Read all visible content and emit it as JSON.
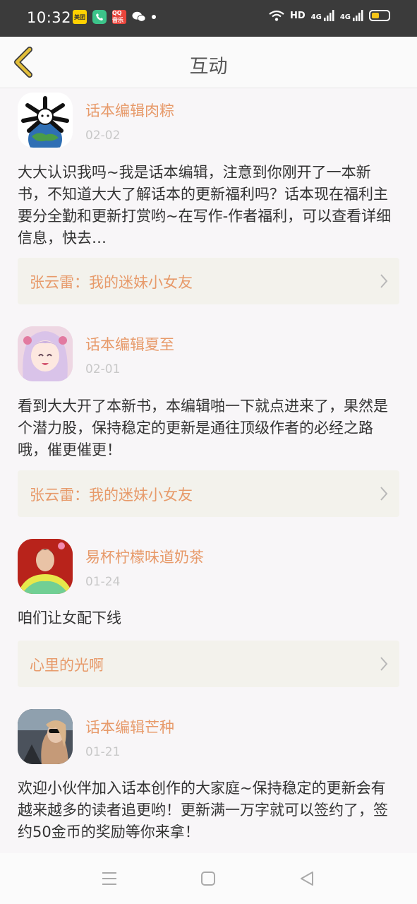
{
  "status_bar": {
    "time": "10:32",
    "apps": [
      "美团",
      "phone-app-icon",
      "QQ音乐",
      "wechat-icon"
    ],
    "network": "HD",
    "signal1": "4G",
    "signal2": "4G",
    "battery_level": 0.45,
    "battery_color": "#f5c518"
  },
  "header": {
    "title": "互动",
    "back_icon": "chevron-left-icon",
    "accent": "#d4a92a"
  },
  "colors": {
    "author": "#e79a6a",
    "date": "#c8c8c8",
    "ref_bg": "#f3f2ec"
  },
  "posts": [
    {
      "author": "话本编辑肉粽",
      "date": "02-02",
      "content": "大大认识我吗~我是话本编辑，注意到你刚开了一本新书，不知道大大了解话本的更新福利吗？话本现在福利主要分全勤和更新打赏哟~在写作-作者福利，可以查看详细信息，快去…",
      "reference": "张云雷：我的迷妹小女友"
    },
    {
      "author": "话本编辑夏至",
      "date": "02-01",
      "content": "看到大大开了本新书，本编辑啪一下就点进来了，果然是个潜力股，保持稳定的更新是通往顶级作者的必经之路哦，催更催更！",
      "reference": "张云雷：我的迷妹小女友"
    },
    {
      "author": "易杯柠檬味道奶茶",
      "date": "01-24",
      "content": "咱们让女配下线",
      "reference": "心里的光啊"
    },
    {
      "author": "话本编辑芒种",
      "date": "01-21",
      "content": "欢迎小伙伴加入话本创作的大家庭~保持稳定的更新会有越来越多的读者追更哟！更新满一万字就可以签约了，签约50金币的奖励等你来拿！"
    }
  ],
  "nav": {
    "menu_icon": "menu-icon",
    "home_icon": "home-square-icon",
    "back_icon": "back-triangle-icon"
  }
}
